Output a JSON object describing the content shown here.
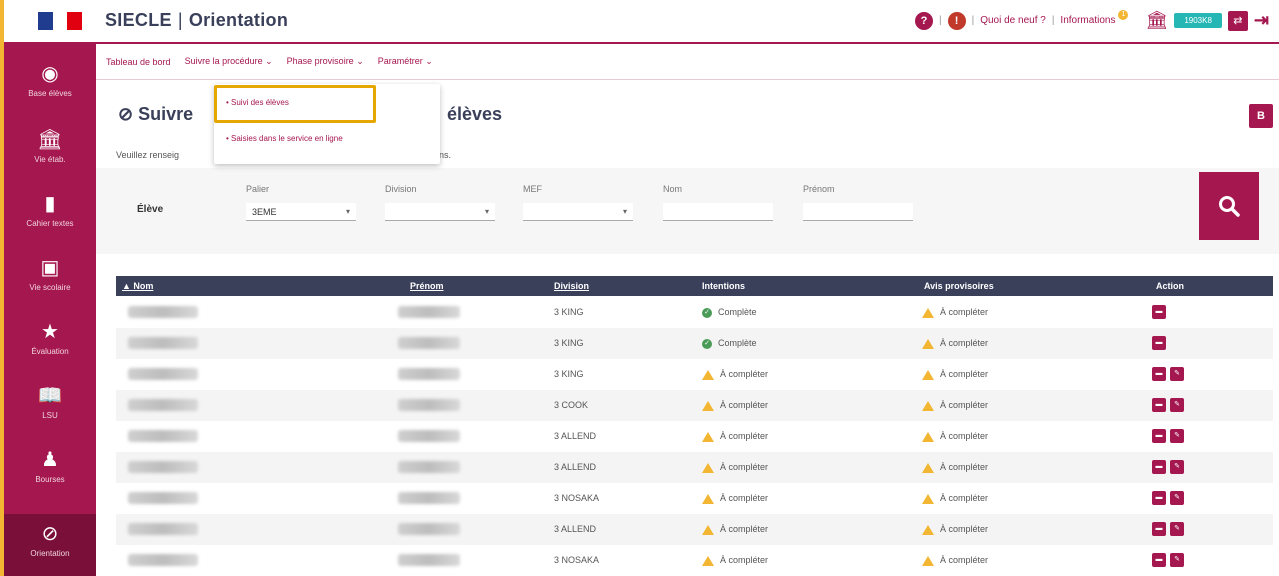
{
  "header": {
    "app_name": "SIECLE",
    "module": "Orientation",
    "help_icon_label": "?",
    "alert_icon_label": "!",
    "whats_new": "Quoi de neuf ?",
    "informations": "Informations",
    "notif_count": "1",
    "uai": "1903K8",
    "brand_color": "#a5174f"
  },
  "sidebar": {
    "items": [
      {
        "label": "Base élèves",
        "icon": "users-icon"
      },
      {
        "label": "Vie étab.",
        "icon": "bank-icon"
      },
      {
        "label": "Cahier textes",
        "icon": "book-icon"
      },
      {
        "label": "Vie scolaire",
        "icon": "calendar-icon"
      },
      {
        "label": "Évaluation",
        "icon": "star-icon"
      },
      {
        "label": "LSU",
        "icon": "open-book-icon"
      },
      {
        "label": "Bourses",
        "icon": "person-icon"
      },
      {
        "label": "Orientation",
        "icon": "compass-icon"
      }
    ]
  },
  "nav": {
    "tabs": [
      {
        "label": "Tableau de bord"
      },
      {
        "label": "Suivre la procédure ⌄"
      },
      {
        "label": "Phase provisoire ⌄"
      },
      {
        "label": "Paramétrer ⌄"
      }
    ]
  },
  "dropdown": {
    "items": [
      {
        "label": "• Suivi des élèves"
      },
      {
        "label": "• Saisies dans le service en ligne"
      }
    ]
  },
  "page": {
    "title_start": "⊘ Suivre",
    "title_end": "élèves",
    "subtitle_start": "Veuillez renseig",
    "subtitle_end": "ns.",
    "pdf_label": "B"
  },
  "filter": {
    "row_label": "Élève",
    "palier_label": "Palier",
    "palier_value": "3EME",
    "division_label": "Division",
    "mef_label": "MEF",
    "nom_label": "Nom",
    "prenom_label": "Prénom"
  },
  "table": {
    "headers": {
      "nom": "▲ Nom",
      "prenom": "Prénom",
      "division": "Division",
      "intentions": "Intentions",
      "avis": "Avis provisoires",
      "action": "Action"
    },
    "rows": [
      {
        "division": "3 KING",
        "intentions": "Complète",
        "intentions_status": "ok",
        "avis": "À compléter",
        "actions": 1
      },
      {
        "division": "3 KING",
        "intentions": "Complète",
        "intentions_status": "ok",
        "avis": "À compléter",
        "actions": 1
      },
      {
        "division": "3 KING",
        "intentions": "À compléter",
        "intentions_status": "warn",
        "avis": "À compléter",
        "actions": 2
      },
      {
        "division": "3 COOK",
        "intentions": "À compléter",
        "intentions_status": "warn",
        "avis": "À compléter",
        "actions": 2
      },
      {
        "division": "3 ALLEND",
        "intentions": "À compléter",
        "intentions_status": "warn",
        "avis": "À compléter",
        "actions": 2
      },
      {
        "division": "3 ALLEND",
        "intentions": "À compléter",
        "intentions_status": "warn",
        "avis": "À compléter",
        "actions": 2
      },
      {
        "division": "3 NOSAKA",
        "intentions": "À compléter",
        "intentions_status": "warn",
        "avis": "À compléter",
        "actions": 2
      },
      {
        "division": "3 ALLEND",
        "intentions": "À compléter",
        "intentions_status": "warn",
        "avis": "À compléter",
        "actions": 2
      },
      {
        "division": "3 NOSAKA",
        "intentions": "À compléter",
        "intentions_status": "warn",
        "avis": "À compléter",
        "actions": 2
      }
    ]
  }
}
